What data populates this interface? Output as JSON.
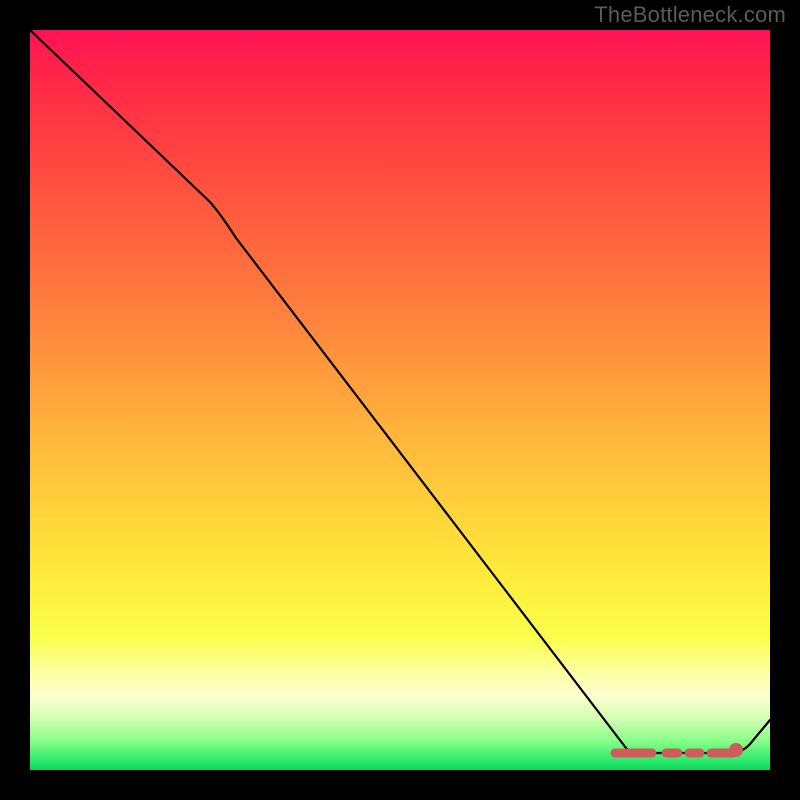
{
  "watermark": "TheBottleneck.com",
  "colors": {
    "background": "#000000",
    "watermark_text": "#5b5b5b",
    "line": "#000000",
    "flat_segment": "#d15a5a",
    "marker": "#d15a5a"
  },
  "chart_data": {
    "type": "line",
    "title": "",
    "xlabel": "",
    "ylabel": "",
    "x_range_pct": [
      0,
      100
    ],
    "y_range_pct": [
      0,
      100
    ],
    "grid": false,
    "legend": false,
    "series": [
      {
        "name": "main-line",
        "points_pct": [
          {
            "x": 0,
            "y": 100
          },
          {
            "x": 25,
            "y": 77
          },
          {
            "x": 80,
            "y": 3
          },
          {
            "x": 95,
            "y": 3
          },
          {
            "x": 100,
            "y": 7
          }
        ]
      }
    ],
    "flat_region": {
      "y_pct": 3,
      "dashes_x_pct": [
        [
          79,
          84
        ],
        [
          86,
          87.5
        ],
        [
          89,
          90.5
        ],
        [
          92,
          95
        ]
      ]
    },
    "marker_pct": {
      "x": 95,
      "y": 3
    },
    "gradient_stops": [
      {
        "pct": 0,
        "hex": "#ff1255"
      },
      {
        "pct": 18,
        "hex": "#ff4840"
      },
      {
        "pct": 55,
        "hex": "#ffb63c"
      },
      {
        "pct": 82,
        "hex": "#faff4a"
      },
      {
        "pct": 90,
        "hex": "#fdffd0"
      },
      {
        "pct": 100,
        "hex": "#0fd45c"
      }
    ]
  }
}
